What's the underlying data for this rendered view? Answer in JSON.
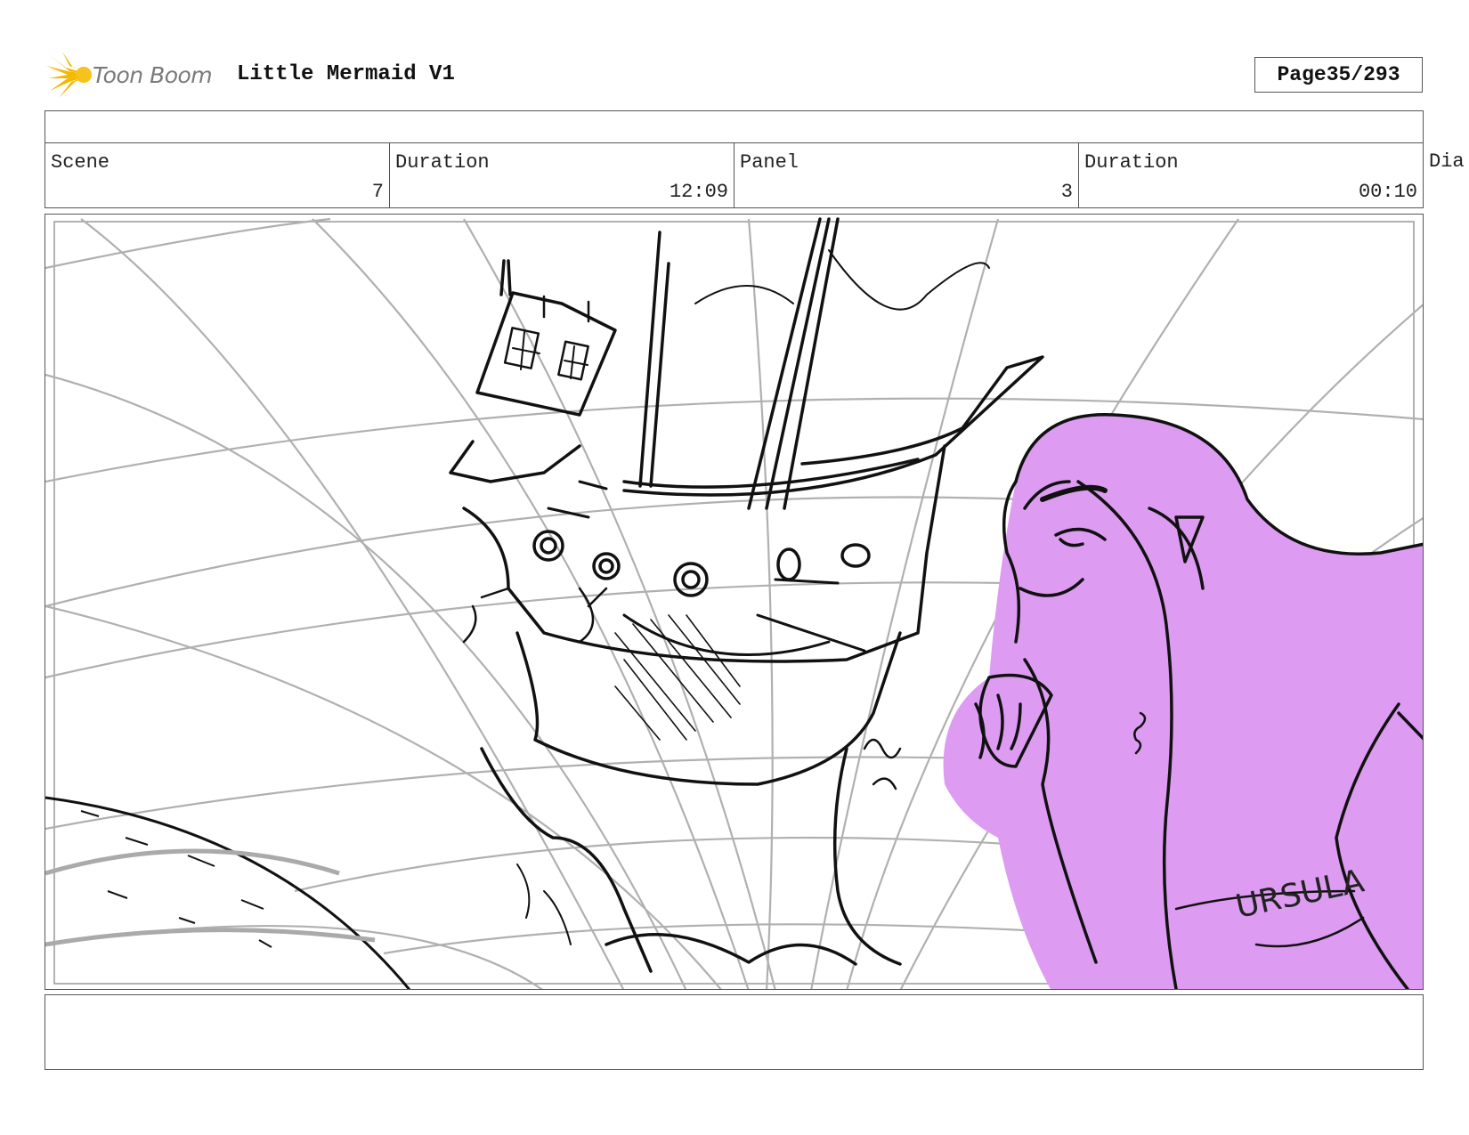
{
  "header": {
    "logo_text": "Toon Boom",
    "project_title": "Little Mermaid V1",
    "page_label": "Page",
    "page_value": "35/293"
  },
  "info": {
    "scene_label": "Scene",
    "scene_value": "7",
    "scene_duration_label": "Duration",
    "scene_duration_value": "12:09",
    "panel_label": "Panel",
    "panel_value": "3",
    "panel_duration_label": "Duration",
    "panel_duration_value": "00:10",
    "extra_label": "Dia"
  },
  "panel": {
    "tattoo_text": "URSULA",
    "highlight_color": "#dd9cf2",
    "line_color": "#111111",
    "grid_color": "#b0b0b0"
  },
  "logo": {
    "icon": "starburst-icon",
    "color": "#f5b800"
  }
}
